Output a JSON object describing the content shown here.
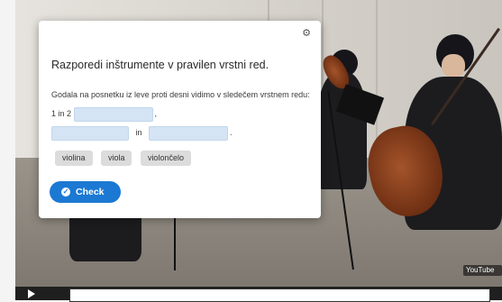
{
  "dialog": {
    "title": "Razporedi inštrumente v pravilen vrstni red.",
    "question": {
      "prefix": "Godala na posnetku iz leve proti desni vidimo v sledečem vrstnem redu: 1 in 2",
      "connector": "in",
      "end": "."
    },
    "options": [
      "violina",
      "viola",
      "violončelo"
    ],
    "check_label": "Check",
    "settings_icon": "gear-icon",
    "check_icon": "check-circle-icon"
  },
  "player": {
    "branding": "YouTube",
    "play_icon": "play-icon"
  }
}
